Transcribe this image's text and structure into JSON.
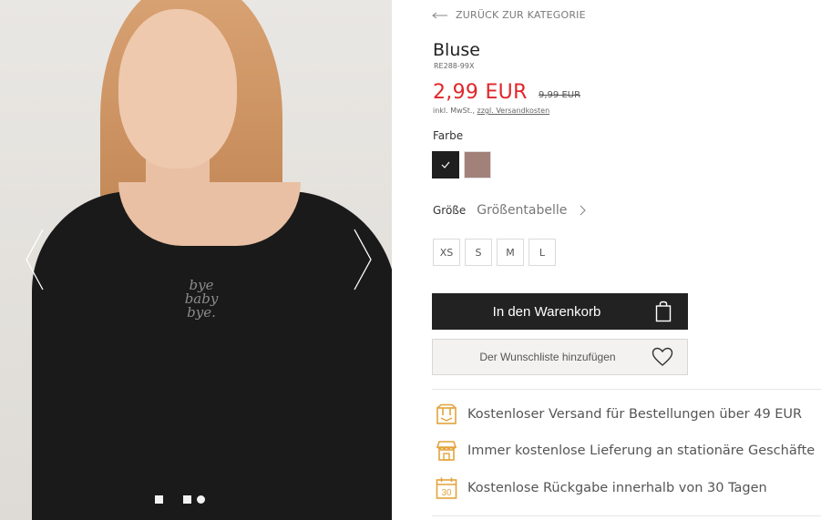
{
  "gallery": {
    "print_text": [
      "bye",
      "baby",
      "bye."
    ],
    "dots": 3,
    "active_dot": 2
  },
  "back_link": "ZURÜCK ZUR KATEGORIE",
  "product": {
    "title": "Bluse",
    "sku": "RE288-99X",
    "price": "2,99 EUR",
    "old_price": "9,99 EUR",
    "tax_prefix": "inkl. MwSt.,",
    "shipping_link": "zzgl. Versandkosten"
  },
  "color": {
    "label": "Farbe",
    "swatches": [
      {
        "name": "black",
        "hex": "#1f1f1f",
        "selected": true
      },
      {
        "name": "pink",
        "hex": "#a2817a",
        "selected": false
      }
    ]
  },
  "size": {
    "label": "Größe",
    "table_link": "Größentabelle",
    "options": [
      "XS",
      "S",
      "M",
      "L"
    ]
  },
  "actions": {
    "add_to_cart": "In den Warenkorb",
    "add_to_wishlist": "Der Wunschliste hinzufügen"
  },
  "benefits": [
    {
      "icon": "delivery-box-icon",
      "text": "Kostenloser Versand für Bestellungen über 49 EUR"
    },
    {
      "icon": "store-icon",
      "text": "Immer kostenlose Lieferung an stationäre Geschäfte"
    },
    {
      "icon": "calendar-30-icon",
      "text": "Kostenlose Rückgabe innerhalb von 30 Tagen"
    }
  ],
  "colors": {
    "price_red": "#e0262a",
    "accent_gold": "#e3a33b",
    "button_dark": "#222222"
  }
}
